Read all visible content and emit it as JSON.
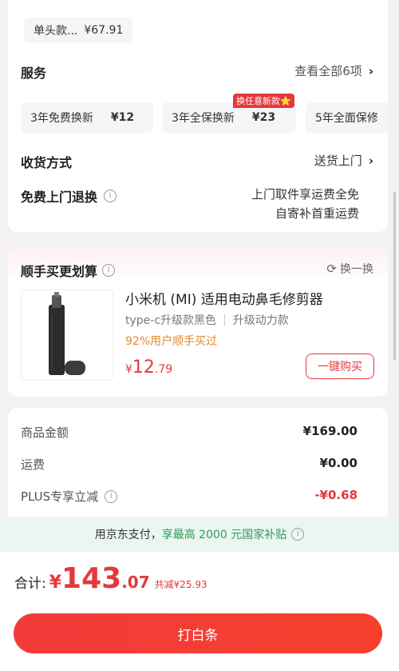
{
  "top_variant": {
    "label": "单头款...",
    "price": "¥67.91"
  },
  "service": {
    "title": "服务",
    "view_all": "查看全部6项",
    "badge": "换任意新款⭐",
    "options": [
      {
        "name": "3年免费换新",
        "price": "¥12"
      },
      {
        "name": "3年全保换新",
        "price": "¥23"
      },
      {
        "name": "5年全面保修",
        "price": ""
      }
    ]
  },
  "delivery": {
    "label": "收货方式",
    "value": "送货上门"
  },
  "free_return": {
    "label": "免费上门退换",
    "line1": "上门取件享运费全免",
    "line2": "自寄补首重运费"
  },
  "recommend": {
    "title": "顺手买更划算",
    "refresh": "换一换",
    "product_name": "小米机 (MI) 适用电动鼻毛修剪器",
    "spec1": "type-c升级款黑色",
    "spec2": "升级动力款",
    "buy_rate": "92%用户顺手买过",
    "price_symbol": "¥",
    "price_int": "12",
    "price_dec": ".79",
    "buy_button": "一键购买"
  },
  "price_list": {
    "rows": [
      {
        "label": "商品金额",
        "value": "¥169.00"
      },
      {
        "label": "运费",
        "value": "¥0.00"
      },
      {
        "label": "PLUS专享立减",
        "value": "-¥0.68"
      }
    ]
  },
  "subsidy": {
    "prefix": "用京东支付，",
    "highlight": "享最高 2000 元国家补贴"
  },
  "footer": {
    "total_label": "合计:",
    "currency": "¥",
    "total_int": "143",
    "total_dec": ".07",
    "saved": "共减¥25.93",
    "pay_button": "打白条"
  },
  "colors": {
    "accent_red": "#e4393c",
    "green": "#2b9b58",
    "orange": "#e08a2a"
  }
}
